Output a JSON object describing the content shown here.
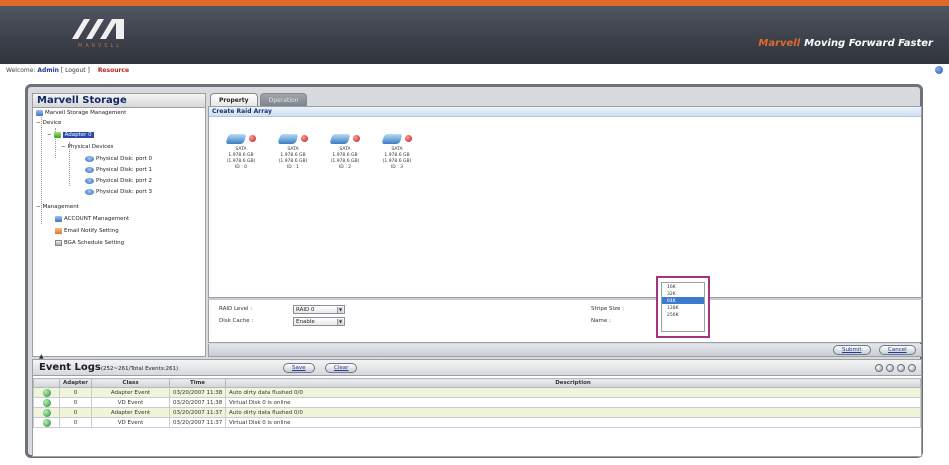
{
  "header": {
    "logo_subtext": "MARVELL",
    "tagline_brand": "Marvell",
    "tagline": "Moving Forward Faster"
  },
  "welcome": {
    "prefix": "Welcome",
    "user": "Admin",
    "logout": "[ Logout ]",
    "resource": "Resource"
  },
  "tree": {
    "title": "Marvell Storage",
    "items": [
      {
        "label": "Marvell Storage Management",
        "icon": "storage-icon"
      },
      {
        "label": "Device",
        "icon": "none"
      },
      {
        "label": "Adapter 0",
        "icon": "adapter-icon",
        "selected": true
      },
      {
        "label": "Physical Devices",
        "icon": "folder-icon"
      },
      {
        "label": "Physical Disk: port 0",
        "icon": "disk-icon"
      },
      {
        "label": "Physical Disk: port 1",
        "icon": "disk-icon"
      },
      {
        "label": "Physical Disk: port 2",
        "icon": "disk-icon"
      },
      {
        "label": "Physical Disk: port 3",
        "icon": "disk-icon"
      },
      {
        "label": "Management",
        "icon": "none"
      },
      {
        "label": "ACCOUNT Management",
        "icon": "account-icon"
      },
      {
        "label": "Email Notify Setting",
        "icon": "email-icon"
      },
      {
        "label": "BGA Schedule Setting",
        "icon": "schedule-icon"
      }
    ]
  },
  "tabs": [
    {
      "label": "Property"
    },
    {
      "label": "Operation"
    }
  ],
  "create": {
    "header": "Create Raid Array",
    "disks": [
      {
        "type": "SATA",
        "size1": "1.978.6 GB",
        "size2": "(1.978.6 GB)",
        "port": "ID : 0"
      },
      {
        "type": "SATA",
        "size1": "1.978.6 GB",
        "size2": "(1.978.6 GB)",
        "port": "ID : 1"
      },
      {
        "type": "SATA",
        "size1": "1.978.6 GB",
        "size2": "(1.978.6 GB)",
        "port": "ID : 2"
      },
      {
        "type": "SATA",
        "size1": "1.978.6 GB",
        "size2": "(1.978.6 GB)",
        "port": "ID : 3"
      }
    ]
  },
  "form": {
    "raid_level_label": "RAID Level :",
    "raid_level_value": "RAID 0",
    "disk_cache_label": "Disk Cache :",
    "disk_cache_value": "Enable",
    "stripe_size_label": "Stripe Size :",
    "name_label": "Name :",
    "stripe_options": [
      "16K",
      "32K",
      "64K",
      "128K",
      "256K"
    ],
    "stripe_selected": "64K"
  },
  "actions": {
    "submit": "Submit",
    "cancel": "Cancel"
  },
  "events": {
    "title": "Event Logs",
    "subtitle": "(252~261/Total Events:261)",
    "save": "Save",
    "clear": "Clear",
    "columns": [
      "Adapter",
      "Class",
      "Time",
      "Description"
    ],
    "rows": [
      {
        "adapter": "0",
        "class": "Adapter Event",
        "time": "03/20/2007 11:38",
        "desc": "Auto dirty data flushed 0/0"
      },
      {
        "adapter": "0",
        "class": "VD Event",
        "time": "03/20/2007 11:38",
        "desc": "Virtual Disk 0 is online"
      },
      {
        "adapter": "0",
        "class": "Adapter Event",
        "time": "03/20/2007 11:37",
        "desc": "Auto dirty data flushed 0/0"
      },
      {
        "adapter": "0",
        "class": "VD Event",
        "time": "03/20/2007 11:37",
        "desc": "Virtual Disk 0 is online"
      }
    ]
  },
  "colors": {
    "accent_orange": "#e06a2c",
    "header_dark": "#3c414b",
    "selection_blue": "#2a49a8",
    "dropdown_highlight": "#a3347e",
    "row_green": "#eef5d9"
  }
}
